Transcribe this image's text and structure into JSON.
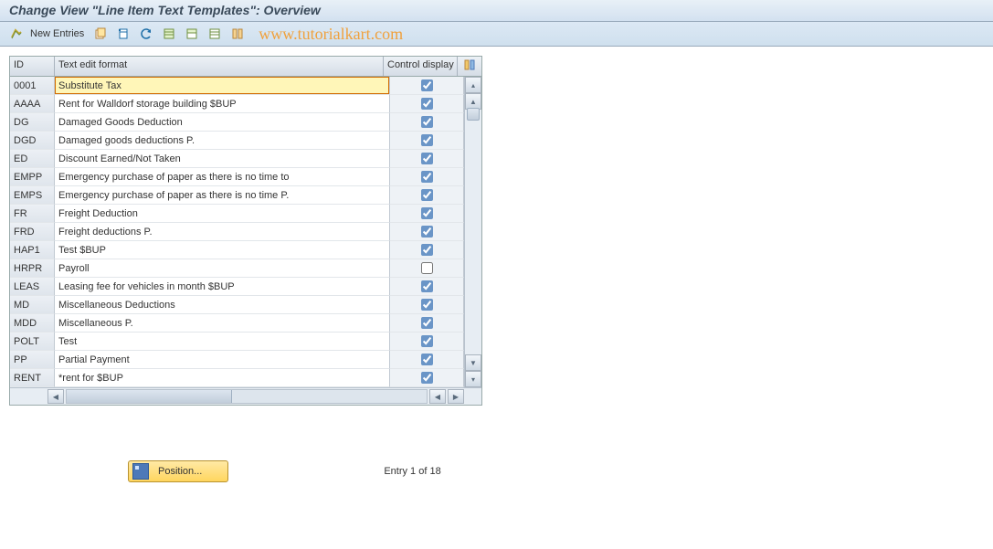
{
  "header": {
    "title": "Change View \"Line Item Text Templates\": Overview"
  },
  "toolbar": {
    "new_entries": "New Entries"
  },
  "watermark": "www.tutorialkart.com",
  "columns": {
    "id": "ID",
    "text_format": "Text edit format",
    "control": "Control display"
  },
  "rows": [
    {
      "id": "0001",
      "text": "Substitute Tax",
      "ctl": true,
      "active": true
    },
    {
      "id": "AAAA",
      "text": "Rent for Walldorf storage building $BUP",
      "ctl": true
    },
    {
      "id": "DG",
      "text": "Damaged Goods Deduction",
      "ctl": true
    },
    {
      "id": "DGD",
      "text": "Damaged goods deductions P.",
      "ctl": true
    },
    {
      "id": "ED",
      "text": "Discount Earned/Not Taken",
      "ctl": true
    },
    {
      "id": "EMPP",
      "text": "Emergency purchase of paper as there is no time to",
      "ctl": true
    },
    {
      "id": "EMPS",
      "text": "Emergency purchase of paper as there is no time P.",
      "ctl": true
    },
    {
      "id": "FR",
      "text": "Freight Deduction",
      "ctl": true
    },
    {
      "id": "FRD",
      "text": "Freight deductions P.",
      "ctl": true
    },
    {
      "id": "HAP1",
      "text": "Test $BUP",
      "ctl": true
    },
    {
      "id": "HRPR",
      "text": "Payroll",
      "ctl": false
    },
    {
      "id": "LEAS",
      "text": "Leasing fee for vehicles in month $BUP",
      "ctl": true
    },
    {
      "id": "MD",
      "text": "Miscellaneous Deductions",
      "ctl": true
    },
    {
      "id": "MDD",
      "text": "Miscellaneous P.",
      "ctl": true
    },
    {
      "id": "POLT",
      "text": "Test",
      "ctl": true
    },
    {
      "id": "PP",
      "text": "Partial Payment",
      "ctl": true
    },
    {
      "id": "RENT",
      "text": "*rent for $BUP",
      "ctl": true
    }
  ],
  "footer": {
    "position_btn": "Position...",
    "entry_text": "Entry 1 of 18"
  }
}
